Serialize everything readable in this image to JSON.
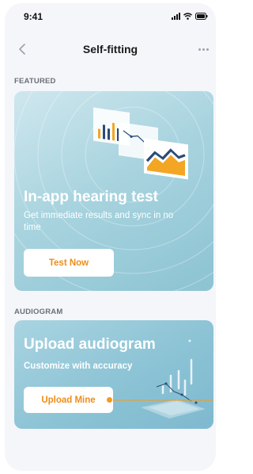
{
  "status_bar": {
    "time": "9:41"
  },
  "nav": {
    "title": "Self-fitting"
  },
  "featured": {
    "section_label": "FEATURED",
    "title": "In-app hearing test",
    "subtitle": "Get immediate results and sync in no time",
    "button_label": "Test Now"
  },
  "audiogram": {
    "section_label": "AUDIOGRAM",
    "title": "Upload audiogram",
    "subtitle": "Customize with accuracy",
    "button_label": "Upload Mine"
  },
  "colors": {
    "accent": "#f08c1a",
    "card_blue": "#a9d4df",
    "background": "#f4f6fa"
  }
}
